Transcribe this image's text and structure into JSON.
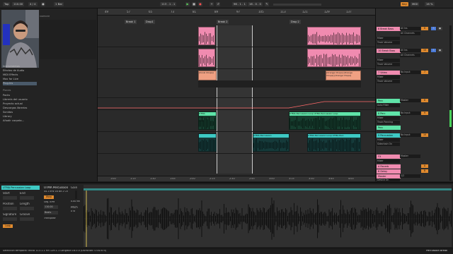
{
  "top": {
    "tap_label": "Tap",
    "tempo": "110.00",
    "time_sig": "4 / 4",
    "metro_label": "1 Bar",
    "position": "113 . 1 . 1",
    "loop_start": "96 . 1 . 1",
    "loop_len": "16 . 0 . 0",
    "key_label": "Key",
    "midi_label": "MIDI",
    "cpu": "16 %"
  },
  "browser": {
    "search_placeholder": "Buscar (Ctrl + F)",
    "header_left": "Colecciones",
    "header_right": "Nombre",
    "categories": [
      "Instrumentos",
      "Efectos de Audio",
      "MIDI Effects",
      "Max for Live",
      "Plug-Ins"
    ],
    "places_header": "Places",
    "places": [
      "Packs",
      "Librería del usuario",
      "Proyecto actual",
      "Descargas librerías",
      "Sonidos",
      "Library",
      "Añadir carpeta..."
    ]
  },
  "arrangement": {
    "ruler": [
      "49",
      "57",
      "65",
      "73",
      "81",
      "89",
      "97",
      "105",
      "113",
      "121",
      "129",
      "137"
    ],
    "locators": [
      "Break 1",
      "Drop1",
      "Break 2",
      "Drop 2"
    ],
    "time_ruler": [
      "1:00",
      "1:15",
      "1:30",
      "1:45",
      "2:00",
      "2:15",
      "2:30",
      "2:45",
      "3:00",
      "3:15",
      "3:30",
      "3:45",
      "4:00",
      "4:15",
      "4:30",
      "4:45"
    ],
    "clip_labels": {
      "vocal_chops": "[Vocal Chops]",
      "orange_chops": "[Orange Chops] [Orange Chops] [Orange Chops]",
      "perc_1": "UTMA Percussion Loop",
      "perc_2": "UTMA Percussion Loop UTMA Percussion Loop",
      "perc_3": "UTMA Percussion",
      "perc_4": "UTMA Percussion Loop UTMA Perc"
    }
  },
  "mixer": {
    "tracks": [
      {
        "name": "6 Break Bass",
        "input": "All Ins",
        "input2": "All Channels",
        "mode": "Mixer",
        "device": "Track Volume",
        "num": "6",
        "color": "#f08bb0"
      },
      {
        "name": "10 Break Bass",
        "input": "All Ins",
        "input2": "All Channels",
        "mode": "Mixer",
        "device": "Track Volume",
        "num": "10",
        "color": "#f08bb0"
      },
      {
        "name": "7 Video",
        "input": "No Input",
        "input2": "",
        "mode": "Mixer",
        "device": "Track Volume",
        "num": "7",
        "color": "#f08bb0"
      },
      {
        "name": "Perc",
        "input": "Master",
        "input2": "",
        "mode": "Mixer",
        "device": "Auto Filter",
        "num": "8",
        "color": "#5fe3a8"
      },
      {
        "name": "8 Perc",
        "input": "No Input",
        "input2": "",
        "mode": "Mixer",
        "device": "Track Panning",
        "num": "9",
        "color": "#5fe3a8"
      },
      {
        "name": "Perc",
        "input": "",
        "input2": "",
        "mode": "Mixer",
        "device": "",
        "num": "",
        "color": "#5fe3a8"
      },
      {
        "name": "9 Percussion",
        "input": "No Input",
        "input2": "",
        "mode": "Mixer",
        "device": "Sidechain On",
        "num": "10",
        "color": "#3ec9c4"
      },
      {
        "name": "FX",
        "input": "Master",
        "input2": "",
        "mode": "Mixer",
        "device": "",
        "num": "",
        "color": "#f08bb0"
      },
      {
        "name": "A Reverb",
        "input": "",
        "input2": "",
        "mode": "",
        "device": "",
        "num": "A",
        "color": "#f08bb0"
      },
      {
        "name": "B Delay",
        "input": "",
        "input2": "",
        "mode": "",
        "device": "",
        "num": "B",
        "color": "#f08bb0"
      },
      {
        "name": "Master",
        "input": "1/2",
        "input2": "",
        "mode": "",
        "device": "Device On",
        "num": "",
        "color": "#f08bb0"
      }
    ]
  },
  "detail": {
    "clip_title": "UTMA Percussion Loop",
    "start_label": "Start",
    "end_label": "End",
    "position_label": "Position",
    "length_label": "Length",
    "signature_label": "Signature",
    "groove_label": "Groove",
    "loop_label": "Loop",
    "sample_name": "UTMA Percussion",
    "sample_info": "44.1 kHz 16 Bit 2 Ch",
    "warp_label": "Warp",
    "seg_bpm": "Seg. BPM",
    "bpm_value": "110.00",
    "gain_label": "Gain",
    "gain_value": "0.00 dB",
    "pitch_label": "Pitch",
    "pitch_value": "0 st",
    "transpose_label": "Transpose",
    "mode_label": "Beats",
    "ruler": [
      "1",
      "1.2",
      "1.3",
      "1.4",
      "2",
      "2.2",
      "2.3",
      "2.4",
      "3",
      "3.2",
      "3.3",
      "3.4",
      "4",
      "4.2",
      "4.3",
      "4.4"
    ]
  },
  "status": {
    "left": "Selección temporal:  Inicio 113.1.1  Fin 129.1.1  Longitud 16.0.0  (Duración: 0:34.675)",
    "right": "Percussion Break"
  },
  "colors": {
    "pink": "#f08bb0",
    "salmon": "#f0a082",
    "green": "#5fe3a8",
    "teal": "#3ec9c4",
    "orange": "#e08a2e",
    "yellow": "#f5c518"
  }
}
